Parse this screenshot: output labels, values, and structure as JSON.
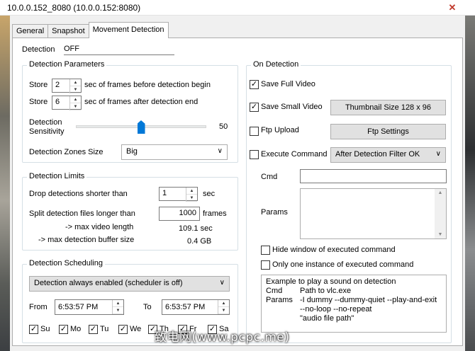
{
  "window": {
    "title": "10.0.0.152_8080 (10.0.0.152:8080)",
    "close_glyph": "✕"
  },
  "tabs": [
    {
      "label": "General",
      "active": false
    },
    {
      "label": "Snapshot",
      "active": false
    },
    {
      "label": "Movement Detection",
      "active": true
    }
  ],
  "detection": {
    "label": "Detection",
    "value": "OFF"
  },
  "params": {
    "legend": "Detection Parameters",
    "store1": {
      "label": "Store",
      "value": "2",
      "suffix": "sec of frames before detection begin"
    },
    "store2": {
      "label": "Store",
      "value": "6",
      "suffix": "sec of frames after detection end"
    },
    "sensitivity": {
      "label_line1": "Detection",
      "label_line2": "Sensitivity",
      "value": "50",
      "level": 50,
      "min": 0,
      "max": 100
    },
    "zones": {
      "label": "Detection Zones Size",
      "selected": "Big"
    }
  },
  "limits": {
    "legend": "Detection Limits",
    "drop": {
      "label": "Drop detections shorter than",
      "value": "1",
      "unit": "sec"
    },
    "split": {
      "label": "Split detection files longer than",
      "value": "1000",
      "unit": "frames"
    },
    "max_video": {
      "label": "-> max video length",
      "value": "109.1 sec"
    },
    "max_buffer": {
      "label": "-> max detection buffer size",
      "value": "0.4 GB"
    }
  },
  "scheduling": {
    "legend": "Detection Scheduling",
    "mode": "Detection always enabled (scheduler is off)",
    "from_label": "From",
    "from_value": "6:53:57 PM",
    "to_label": "To",
    "to_value": "6:53:57 PM",
    "days": [
      {
        "label": "Su",
        "checked": true
      },
      {
        "label": "Mo",
        "checked": true
      },
      {
        "label": "Tu",
        "checked": true
      },
      {
        "label": "We",
        "checked": true
      },
      {
        "label": "Th",
        "checked": true
      },
      {
        "label": "Fr",
        "checked": true
      },
      {
        "label": "Sa",
        "checked": true
      }
    ]
  },
  "on_detection": {
    "legend": "On Detection",
    "save_full": {
      "label": "Save Full Video",
      "checked": true
    },
    "save_small": {
      "label": "Save Small Video",
      "checked": true
    },
    "thumbnail_button": "Thumbnail Size 128 x 96",
    "ftp_upload": {
      "label": "Ftp Upload",
      "checked": false
    },
    "ftp_settings_button": "Ftp Settings",
    "execute": {
      "label": "Execute Command",
      "checked": false,
      "selected": "After Detection Filter OK"
    },
    "cmd_label": "Cmd",
    "cmd_value": "",
    "params_label": "Params",
    "params_value": "",
    "hide_window": {
      "label": "Hide window of executed command",
      "checked": false
    },
    "one_instance": {
      "label": "Only one instance of executed command",
      "checked": false
    },
    "example": {
      "line1": "Example to play a sound on detection",
      "cmd_key": "Cmd",
      "cmd_val": "Path to vlc.exe",
      "params_key": "Params",
      "params_val1": "-I dummy --dummy-quiet --play-and-exit",
      "params_val2": "--no-loop --no-repeat",
      "params_val3": "\"audio file path\""
    }
  },
  "watermark": "致电网(www.pcpc.me)"
}
